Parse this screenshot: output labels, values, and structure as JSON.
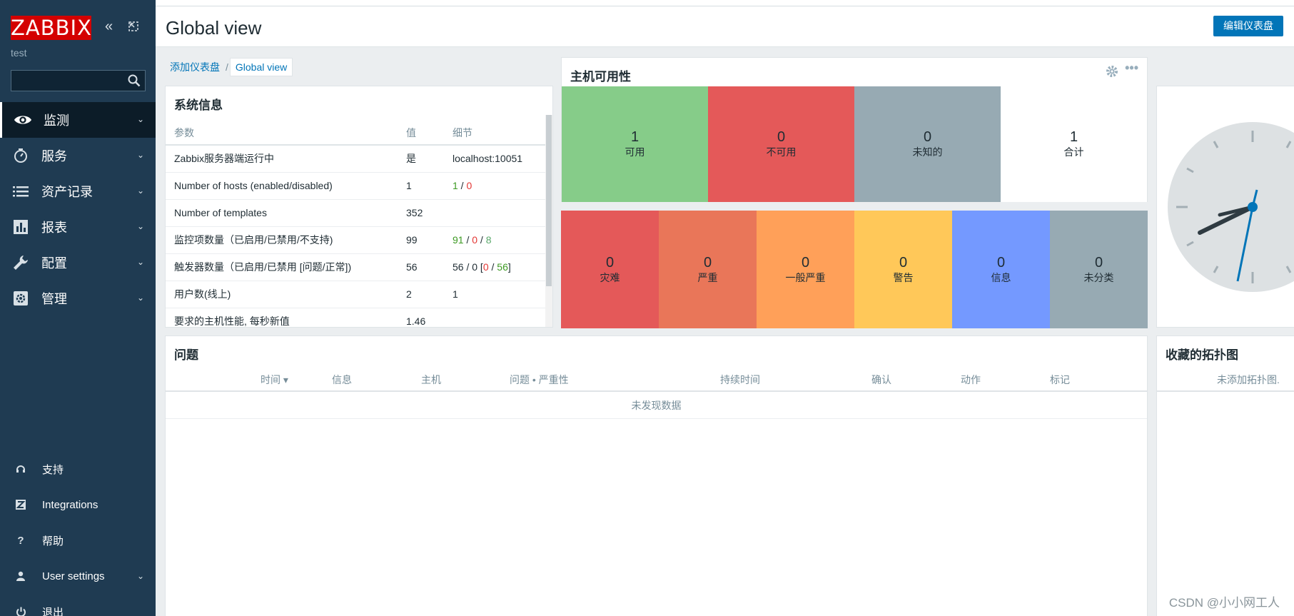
{
  "sidebar": {
    "logo": "ZABBIX",
    "server_name": "test",
    "search": {
      "value": "",
      "placeholder": ""
    },
    "items": [
      {
        "label": "监测",
        "icon": "eye-icon",
        "active": true
      },
      {
        "label": "服务",
        "icon": "stopwatch-icon"
      },
      {
        "label": "资产记录",
        "icon": "list-icon"
      },
      {
        "label": "报表",
        "icon": "bar-chart-icon"
      },
      {
        "label": "配置",
        "icon": "wrench-icon"
      },
      {
        "label": "管理",
        "icon": "gear-icon"
      }
    ],
    "bottom_items": [
      {
        "label": "支持",
        "icon": "headset-icon"
      },
      {
        "label": "Integrations",
        "icon": "zabbix-z-icon"
      },
      {
        "label": "帮助",
        "icon": "question-icon"
      },
      {
        "label": "User settings",
        "icon": "user-icon"
      },
      {
        "label": "退出",
        "icon": "power-icon"
      }
    ]
  },
  "header": {
    "title": "Global view",
    "edit_button": "编辑仪表盘"
  },
  "breadcrumb": {
    "parent": "添加仪表盘",
    "separator": "/",
    "current": "Global view"
  },
  "system_info": {
    "title": "系统信息",
    "columns": [
      "参数",
      "值",
      "细节"
    ],
    "rows": [
      {
        "param": "Zabbix服务器端运行中",
        "value": "是",
        "detail": "localhost:10051"
      },
      {
        "param": "Number of hosts (enabled/disabled)",
        "value": "1",
        "detail_parts": [
          "1",
          " / ",
          "0"
        ]
      },
      {
        "param": "Number of templates",
        "value": "352",
        "detail": ""
      },
      {
        "param": "监控项数量（已启用/已禁用/不支持)",
        "value": "99",
        "detail_parts": [
          "91",
          " / ",
          "0",
          " / ",
          "8"
        ]
      },
      {
        "param": "触发器数量（已启用/已禁用 [问题/正常])",
        "value": "56",
        "detail_parts": [
          "56 / 0 [",
          "0",
          " / ",
          "56",
          "]"
        ]
      },
      {
        "param": "用户数(线上)",
        "value": "2",
        "detail": "1"
      },
      {
        "param": "要求的主机性能, 每秒新值",
        "value": "1.46",
        "detail": ""
      }
    ]
  },
  "host_availability": {
    "title": "主机可用性",
    "cells": [
      {
        "count": "1",
        "label": "可用",
        "color": "#86cc89"
      },
      {
        "count": "0",
        "label": "不可用",
        "color": "#e45959"
      },
      {
        "count": "0",
        "label": "未知的",
        "color": "#97aab3"
      },
      {
        "count": "1",
        "label": "合计",
        "color": "#ffffff"
      }
    ]
  },
  "severity": {
    "cells": [
      {
        "count": "0",
        "label": "灾难",
        "color": "#e45959"
      },
      {
        "count": "0",
        "label": "严重",
        "color": "#e97659"
      },
      {
        "count": "0",
        "label": "一般严重",
        "color": "#ffa059"
      },
      {
        "count": "0",
        "label": "警告",
        "color": "#ffc859"
      },
      {
        "count": "0",
        "label": "信息",
        "color": "#7499ff"
      },
      {
        "count": "0",
        "label": "未分类",
        "color": "#97aab3"
      }
    ]
  },
  "problems": {
    "title": "问题",
    "columns": [
      "时间 ▾",
      "信息",
      "主机",
      "问题 • 严重性",
      "持续时间",
      "确认",
      "动作",
      "标记"
    ],
    "empty": "未发现数据"
  },
  "maps": {
    "title": "收藏的拓扑图",
    "empty": "未添加拓扑图."
  },
  "watermark": "CSDN @小小网工人"
}
